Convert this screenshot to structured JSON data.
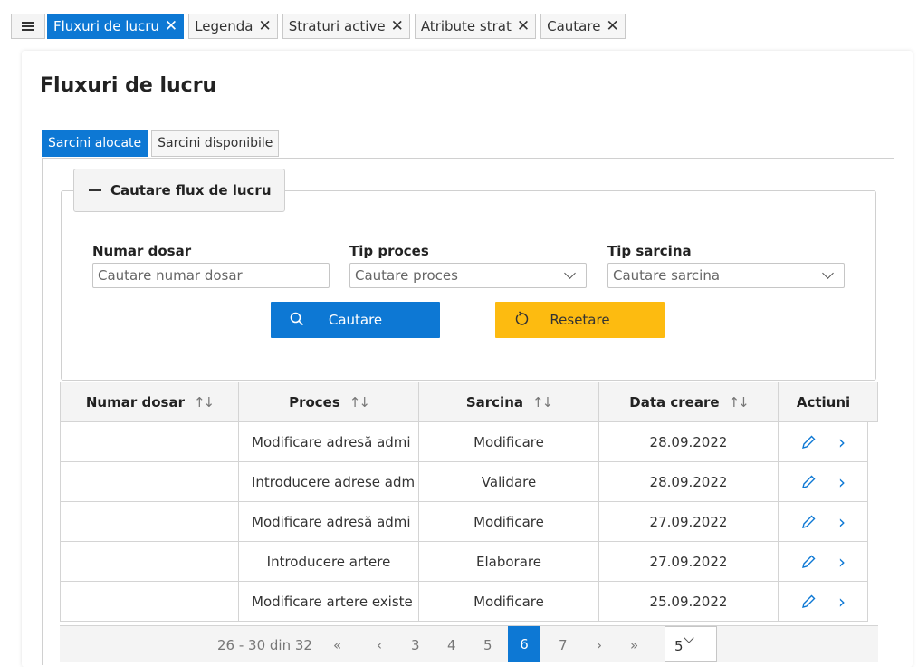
{
  "top_tabs": [
    {
      "label": "Fluxuri de lucru",
      "active": true
    },
    {
      "label": "Legenda",
      "active": false
    },
    {
      "label": "Straturi active",
      "active": false
    },
    {
      "label": "Atribute strat",
      "active": false
    },
    {
      "label": "Cautare",
      "active": false
    }
  ],
  "page": {
    "title": "Fluxuri de lucru"
  },
  "inner_tabs": [
    {
      "label": "Sarcini alocate",
      "active": true
    },
    {
      "label": "Sarcini disponibile",
      "active": false
    }
  ],
  "search_panel": {
    "legend": "Cautare flux de lucru",
    "fields": {
      "numar_dosar": {
        "label": "Numar dosar",
        "placeholder": "Cautare numar dosar"
      },
      "tip_proces": {
        "label": "Tip proces",
        "placeholder": "Cautare proces"
      },
      "tip_sarcina": {
        "label": "Tip sarcina",
        "placeholder": "Cautare sarcina"
      }
    },
    "search_button": "Cautare",
    "reset_button": "Resetare"
  },
  "table": {
    "columns": [
      "Numar dosar",
      "Proces",
      "Sarcina",
      "Data creare",
      "Actiuni"
    ],
    "rows": [
      {
        "numar_dosar": "",
        "proces": "Modificare adresă admi",
        "sarcina": "Modificare",
        "data": "28.09.2022"
      },
      {
        "numar_dosar": "",
        "proces": "Introducere adrese adm",
        "sarcina": "Validare",
        "data": "28.09.2022"
      },
      {
        "numar_dosar": "",
        "proces": "Modificare adresă admi",
        "sarcina": "Modificare",
        "data": "27.09.2022"
      },
      {
        "numar_dosar": "",
        "proces": "Introducere artere",
        "sarcina": "Elaborare",
        "data": "27.09.2022"
      },
      {
        "numar_dosar": "",
        "proces": "Modificare artere existe",
        "sarcina": "Modificare",
        "data": "25.09.2022"
      }
    ]
  },
  "pager": {
    "range": "26 - 30 din 32",
    "first": "«",
    "prev": "‹",
    "pages": [
      "3",
      "4",
      "5",
      "6",
      "7"
    ],
    "current": "6",
    "next": "›",
    "last": "»",
    "page_size": "5"
  },
  "colors": {
    "accent": "#0d78d4",
    "reset": "#fdbb10"
  }
}
